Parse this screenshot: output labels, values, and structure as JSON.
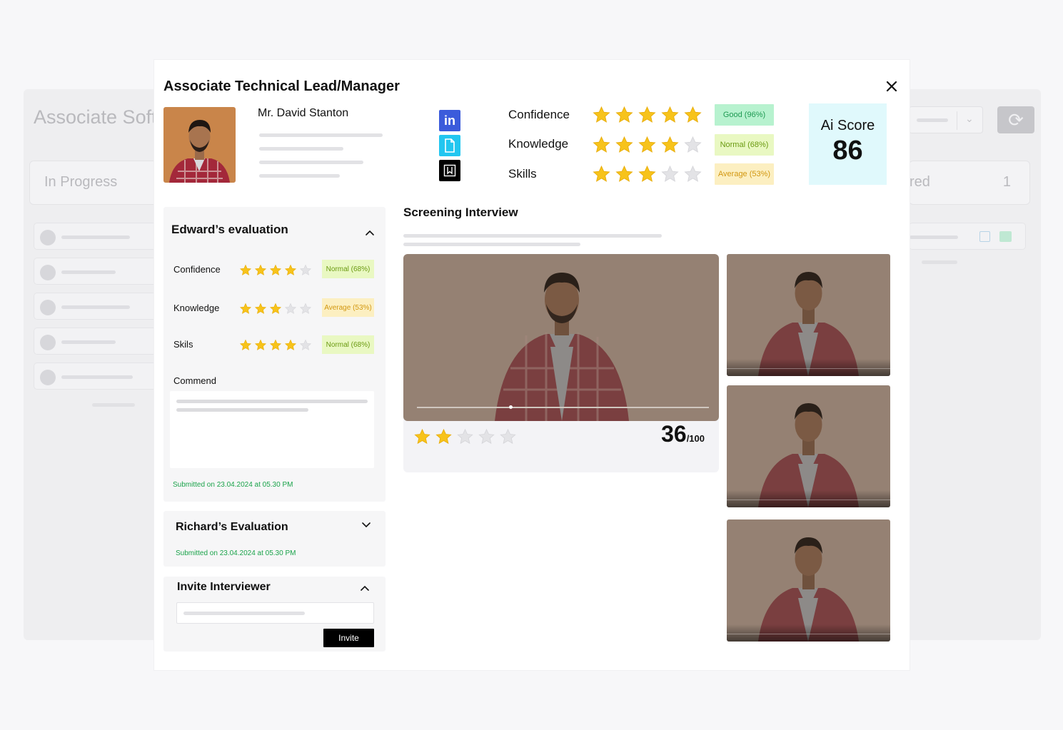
{
  "background": {
    "title": "Associate Soft",
    "left_column_label": "In Progress",
    "right_column_label": "red",
    "right_column_count": "1",
    "refresh_icon": "refresh-icon"
  },
  "modal": {
    "title": "Associate Technical Lead/Manager",
    "close_icon": "close-icon",
    "candidate": {
      "name": "Mr. David Stanton"
    },
    "social_links": [
      {
        "name": "linkedin-icon",
        "label": "in",
        "color": "#3b5bdb"
      },
      {
        "name": "document-icon",
        "color": "#22c6f0"
      },
      {
        "name": "bookmark-icon",
        "color": "#000000"
      }
    ],
    "metrics": [
      {
        "label": "Confidence",
        "stars": 5,
        "badge": "Good (96%)",
        "level": "good"
      },
      {
        "label": "Knowledge",
        "stars": 4,
        "badge": "Normal (68%)",
        "level": "normal"
      },
      {
        "label": "Skills",
        "stars": 3,
        "badge": "Average (53%)",
        "level": "avg"
      }
    ],
    "ai_score": {
      "label": "Ai Score",
      "value": "86"
    },
    "edward_evaluation": {
      "title": "Edward’s evaluation",
      "items": [
        {
          "label": "Confidence",
          "stars": 4,
          "badge": "Normal (68%)",
          "level": "normal"
        },
        {
          "label": "Knowledge",
          "stars": 3,
          "badge": "Average (53%)",
          "level": "avg"
        },
        {
          "label": "Skils",
          "stars": 4,
          "badge": "Normal (68%)",
          "level": "normal"
        }
      ],
      "commend_label": "Commend",
      "submitted": "Submitted on 23.04.2024 at 05.30 PM"
    },
    "richard_evaluation": {
      "title": "Richard’s Evaluation",
      "submitted": "Submitted on 23.04.2024 at 05.30 PM"
    },
    "invite": {
      "title": "Invite Interviewer",
      "button": "Invite"
    },
    "screening": {
      "title": "Screening Interview",
      "video_stars": 2,
      "score": "36",
      "score_max": "/100",
      "progress": 0.32
    },
    "colors": {
      "star": "#f7c31b",
      "star_empty": "#e3e3e6",
      "accent_green": "#1aa34a",
      "ai_score_bg": "#e0f9fc"
    }
  }
}
